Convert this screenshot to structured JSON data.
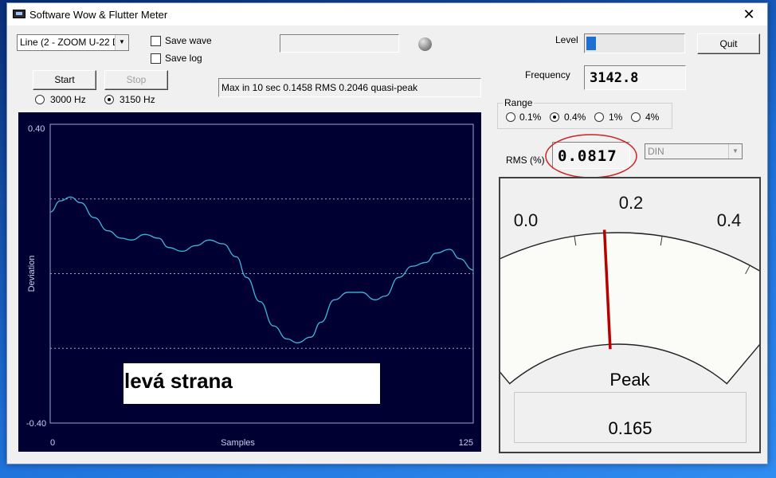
{
  "window": {
    "title": "Software Wow & Flutter Meter",
    "close_glyph": "✕"
  },
  "input": {
    "device_value": "Line (2 - ZOOM U-22 Dr"
  },
  "options": {
    "save_wave": "Save wave",
    "save_log": "Save log"
  },
  "buttons": {
    "start": "Start",
    "stop": "Stop",
    "quit": "Quit"
  },
  "freq_select": {
    "options": [
      {
        "label": "3000 Hz",
        "selected": false
      },
      {
        "label": "3150 Hz",
        "selected": true
      }
    ]
  },
  "status": {
    "text": "Max in 10 sec 0.1458 RMS 0.2046 quasi-peak"
  },
  "level": {
    "label": "Level",
    "fill_fraction": 0.1
  },
  "frequency": {
    "label": "Frequency",
    "value": "3142.8"
  },
  "range": {
    "title": "Range",
    "options": [
      {
        "label": "0.1%",
        "selected": false
      },
      {
        "label": "0.4%",
        "selected": true
      },
      {
        "label": "1%",
        "selected": false
      },
      {
        "label": "4%",
        "selected": false
      }
    ]
  },
  "rms": {
    "label": "RMS (%)",
    "value": "0.0817",
    "weighting": "DIN"
  },
  "meter": {
    "scale_min": "0.0",
    "scale_mid": "0.2",
    "scale_max": "0.4",
    "needle_value": 0.2,
    "peak_label": "Peak",
    "peak_value": "0.165"
  },
  "chart_data": {
    "type": "line",
    "ylabel": "Deviation",
    "xlabel": "Samples",
    "y_top_label": "0.40",
    "y_bottom_label": "-0.40",
    "x_start_label": "0",
    "x_end_label": "125",
    "ylim": [
      -0.4,
      0.4
    ],
    "xlim": [
      0,
      125
    ],
    "grid": "dotted horizontal",
    "line_color": "#3fb7d8",
    "series": [
      {
        "values": [
          {
            "x": 0,
            "y": 0.165
          },
          {
            "x": 3,
            "y": 0.195
          },
          {
            "x": 6,
            "y": 0.205
          },
          {
            "x": 9,
            "y": 0.19
          },
          {
            "x": 13,
            "y": 0.15
          },
          {
            "x": 17,
            "y": 0.115
          },
          {
            "x": 21,
            "y": 0.095
          },
          {
            "x": 24,
            "y": 0.09
          },
          {
            "x": 28,
            "y": 0.105
          },
          {
            "x": 32,
            "y": 0.095
          },
          {
            "x": 35,
            "y": 0.07
          },
          {
            "x": 39,
            "y": 0.06
          },
          {
            "x": 43,
            "y": 0.075
          },
          {
            "x": 47,
            "y": 0.09
          },
          {
            "x": 51,
            "y": 0.08
          },
          {
            "x": 55,
            "y": 0.045
          },
          {
            "x": 58,
            "y": -0.01
          },
          {
            "x": 62,
            "y": -0.075
          },
          {
            "x": 66,
            "y": -0.14
          },
          {
            "x": 70,
            "y": -0.175
          },
          {
            "x": 73,
            "y": -0.185
          },
          {
            "x": 77,
            "y": -0.17
          },
          {
            "x": 80,
            "y": -0.13
          },
          {
            "x": 84,
            "y": -0.07
          },
          {
            "x": 88,
            "y": -0.05
          },
          {
            "x": 92,
            "y": -0.05
          },
          {
            "x": 96,
            "y": -0.07
          },
          {
            "x": 99,
            "y": -0.06
          },
          {
            "x": 103,
            "y": -0.01
          },
          {
            "x": 107,
            "y": 0.02
          },
          {
            "x": 111,
            "y": 0.03
          },
          {
            "x": 114,
            "y": 0.055
          },
          {
            "x": 118,
            "y": 0.065
          },
          {
            "x": 121,
            "y": 0.04
          },
          {
            "x": 125,
            "y": 0.01
          }
        ]
      }
    ]
  },
  "overlay": {
    "caption": "levá strana"
  }
}
